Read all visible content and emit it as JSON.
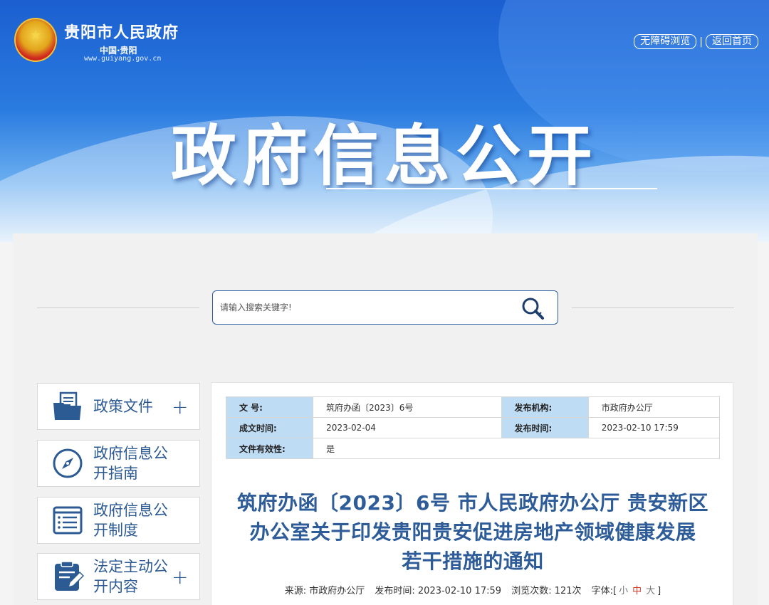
{
  "header": {
    "site_name": "贵阳市人民政府",
    "site_sub": "中国·贵阳",
    "site_url": "www.guiyang.gov.cn",
    "links": [
      {
        "label": "无障碍浏览"
      },
      {
        "label": "返回首页"
      }
    ],
    "separator": "|",
    "big_title": "政府信息公开"
  },
  "search": {
    "placeholder": "请输入搜索关键字!"
  },
  "sidebar": {
    "items": [
      {
        "label": "政策文件",
        "icon": "folder-document-icon",
        "has_plus": true
      },
      {
        "label": "政府信息公开指南",
        "icon": "compass-icon",
        "has_plus": false
      },
      {
        "label": "政府信息公开制度",
        "icon": "list-document-icon",
        "has_plus": false
      },
      {
        "label": "法定主动公开内容",
        "icon": "clipboard-edit-icon",
        "has_plus": true
      }
    ],
    "plus": "+"
  },
  "meta_table": {
    "doc_no_label": "文 号:",
    "doc_no": "筑府办函〔2023〕6号",
    "org_label": "发布机构:",
    "org": "市政府办公厅",
    "created_label": "成文时间:",
    "created": "2023-02-04",
    "published_label": "发布时间:",
    "published": "2023-02-10 17:59",
    "validity_label": "文件有效性:",
    "validity": "是"
  },
  "article": {
    "title_lines": [
      "筑府办函〔2023〕6号 市人民政府办公厅 贵安新区",
      "办公室关于印发贵阳贵安促进房地产领域健康发展",
      "若干措施的通知"
    ],
    "source": "来源: 市政府办公厅",
    "publish_time": "发布时间: 2023-02-10 17:59",
    "views": "浏览次数: 121次",
    "font_label": "字体:[",
    "font_small": "小",
    "font_mid": "中",
    "font_large": "大",
    "font_close": "]"
  },
  "colors": {
    "banner_blue": "#2a7be0",
    "title_blue": "#2e5c98",
    "table_key_bg": "#bfdcf5"
  }
}
